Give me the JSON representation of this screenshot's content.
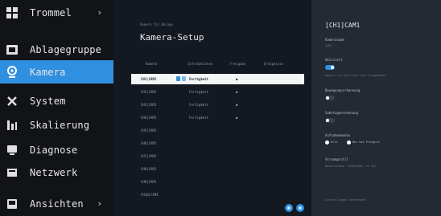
{
  "sidebar": {
    "items": [
      {
        "icon": "grid-icon",
        "label": "Trommel",
        "arrow": "›",
        "active": false
      },
      {
        "icon": "dashboard-icon",
        "label": "Ablagegruppe",
        "arrow": "",
        "active": false
      },
      {
        "icon": "camera-icon",
        "label": "Kamera",
        "arrow": "",
        "active": true
      },
      {
        "icon": "tools-icon",
        "label": "System",
        "arrow": "",
        "active": false
      },
      {
        "icon": "equalizer-icon",
        "label": "Skalierung",
        "arrow": "",
        "active": false
      },
      {
        "icon": "diagnosis-icon",
        "label": "Diagnose",
        "arrow": "",
        "active": false
      },
      {
        "icon": "network-icon",
        "label": "Netzwerk",
        "arrow": "",
        "active": false
      },
      {
        "icon": "monitor-icon",
        "label": "Ansichten",
        "arrow": "›",
        "active": false
      }
    ]
  },
  "main": {
    "breadcrumb": "Kamera für Ablage",
    "title": "Kamera-Setup",
    "columns": [
      "Kamera",
      "Informationen",
      "Freigabe",
      "Ereignisse"
    ],
    "rows": [
      {
        "name": "CH1|CAM1",
        "info": "Fertigkeit",
        "flag": "●",
        "selected": true
      },
      {
        "name": "CH2|CAM1",
        "info": "Fertigkeit",
        "flag": "●",
        "selected": false
      },
      {
        "name": "CH3|CAM1",
        "info": "Fertigkeit",
        "flag": "●",
        "selected": false
      },
      {
        "name": "CH4|CAM1",
        "info": "Fertigkeit",
        "flag": "●",
        "selected": false
      },
      {
        "name": "CH5|CAM1",
        "info": "",
        "flag": "",
        "selected": false
      },
      {
        "name": "CH6|CAM1",
        "info": "",
        "flag": "",
        "selected": false
      },
      {
        "name": "CH7|CAM1",
        "info": "",
        "flag": "",
        "selected": false
      },
      {
        "name": "CH8|CAM1",
        "info": "",
        "flag": "",
        "selected": false
      },
      {
        "name": "CH9|CAM1",
        "info": "",
        "flag": "",
        "selected": false
      },
      {
        "name": "CH10|CAM1",
        "info": "",
        "flag": "",
        "selected": false
      }
    ]
  },
  "detail": {
    "title": "[CH1]CAM1",
    "name_label": "Kameraname",
    "name_value": "CAM1",
    "aktiv_label": "Aktiviert",
    "aktiv_sub": "Kamera ist aktiviert und freigegeben",
    "bewegung_label": "Bewegungserkennung",
    "sabotage_label": "Sabotageerkennung",
    "aufnahme_label": "Aufnahmemodus",
    "radio1": "Alle",
    "radio2": "Nur bei Ereignis",
    "profil_label": "Streamprofil",
    "profil_value": "Hauptstream, 1920x1080, 25 fps",
    "footer": "Einstellungen übernehmen"
  }
}
